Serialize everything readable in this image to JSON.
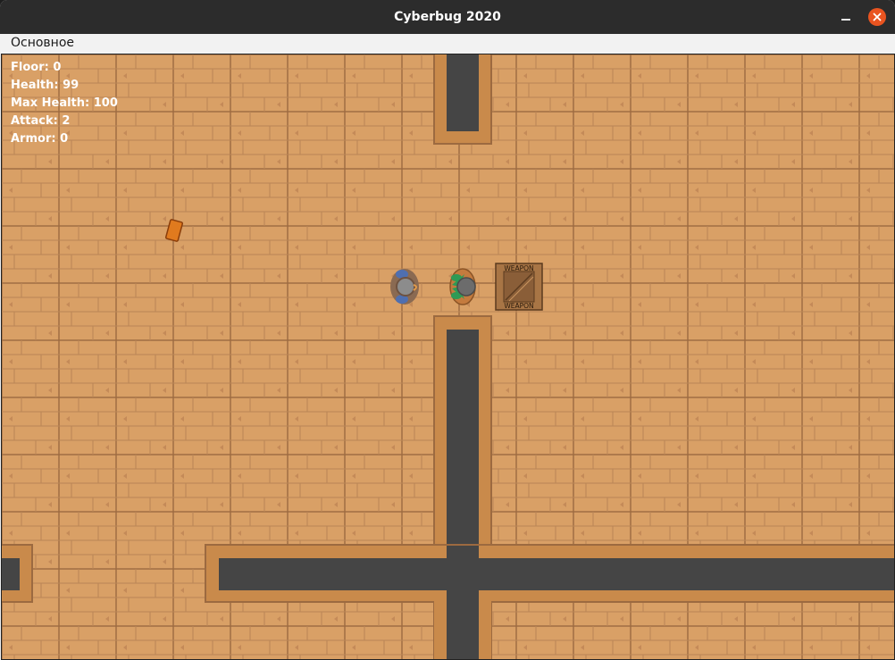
{
  "window": {
    "title": "Cyberbug 2020",
    "minimize_icon": "minimize-icon",
    "close_icon": "close-icon",
    "accent": "#e95420"
  },
  "menu": {
    "items": [
      "Основное"
    ]
  },
  "hud": {
    "floor": "Floor: 0",
    "health": "Health: 99",
    "max_health": "Max Health: 100",
    "attack": "Attack: 2",
    "armor": "Armor: 0"
  },
  "game": {
    "floor_color": "#d9a066",
    "wall_color": "#454545",
    "wall_border_color": "#c98a4b",
    "crate": {
      "label_top": "WEAPON",
      "label_bottom": "WEAPON"
    }
  }
}
